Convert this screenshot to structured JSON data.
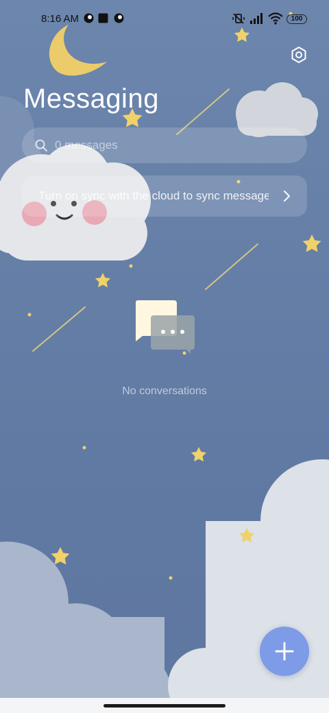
{
  "status_bar": {
    "time": "8:16 AM",
    "battery": "100"
  },
  "header": {
    "title": "Messaging",
    "settings_icon": "settings-icon"
  },
  "search": {
    "placeholder": "0 messages"
  },
  "sync_banner": {
    "text": "Turn on sync with the cloud to sync messages",
    "chevron_icon": "chevron-right-icon"
  },
  "empty_state": {
    "message": "No conversations"
  },
  "fab": {
    "icon": "plus-icon"
  },
  "colors": {
    "background": "#6079a2",
    "accent": "#7d9be6",
    "star": "#f0d16a"
  }
}
